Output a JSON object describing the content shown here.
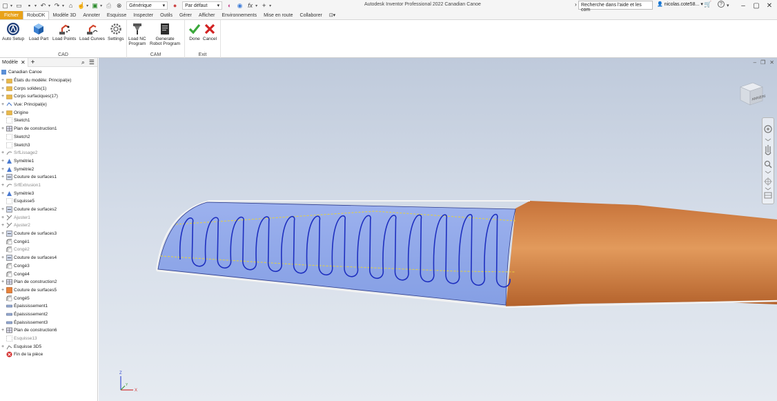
{
  "titlebar": {
    "app_title": "Autodesk Inventor Professional 2022   Canadian Canoe",
    "material": "Générique",
    "appearance": "Par défaut",
    "fx": "fx",
    "search_placeholder": "Recherche dans l'aide et les com",
    "user": "nicolas.cote58...",
    "help": "?"
  },
  "menu": {
    "tabs": [
      "Fichier",
      "RoboDK",
      "Modèle 3D",
      "Annoter",
      "Esquisse",
      "Inspecter",
      "Outils",
      "Gérer",
      "Afficher",
      "Environnements",
      "Mise en route",
      "Collaborer",
      "⊡▾"
    ],
    "active": "RoboDK"
  },
  "ribbon": {
    "groups": [
      {
        "label": "CAD",
        "buttons": [
          {
            "line1": "Auto Setup",
            "line2": ""
          },
          {
            "line1": "Load Part",
            "line2": ""
          },
          {
            "line1": "Load Points",
            "line2": ""
          },
          {
            "line1": "Load Curves",
            "line2": ""
          },
          {
            "line1": "Settings",
            "line2": ""
          }
        ]
      },
      {
        "label": "CAM",
        "buttons": [
          {
            "line1": "Load NC",
            "line2": "Program"
          },
          {
            "line1": "Generate",
            "line2": "Robot Program"
          }
        ]
      },
      {
        "label": "Exit",
        "buttons": [
          {
            "line1": "Done",
            "line2": ""
          },
          {
            "line1": "Cancel",
            "line2": ""
          }
        ]
      }
    ]
  },
  "browser": {
    "tab": "Modèle",
    "root": "Canadian Canoe",
    "nodes": [
      {
        "label": "États du modèle: Principal(e)",
        "icon": "folder",
        "exp": "+",
        "dim": false
      },
      {
        "label": "Corps solides(1)",
        "icon": "folder",
        "exp": "+",
        "dim": false
      },
      {
        "label": "Corps surfaciques(17)",
        "icon": "folder",
        "exp": "+",
        "dim": false
      },
      {
        "label": "Vue: Principal(e)",
        "icon": "view",
        "exp": "+",
        "dim": false
      },
      {
        "label": "Origine",
        "icon": "folder",
        "exp": "+",
        "dim": false
      },
      {
        "label": "Sketch1",
        "icon": "sketch",
        "exp": "",
        "dim": false
      },
      {
        "label": "Plan de construction1",
        "icon": "plane",
        "exp": "+",
        "dim": false
      },
      {
        "label": "Sketch2",
        "icon": "sketch",
        "exp": "",
        "dim": false
      },
      {
        "label": "Sketch3",
        "icon": "sketch",
        "exp": "",
        "dim": false
      },
      {
        "label": "SrfLissage2",
        "icon": "surface",
        "exp": "+",
        "dim": true
      },
      {
        "label": "Symétrie1",
        "icon": "mirror",
        "exp": "+",
        "dim": false
      },
      {
        "label": "Symétrie2",
        "icon": "mirror",
        "exp": "+",
        "dim": false
      },
      {
        "label": "Couture de surfaces1",
        "icon": "stitch",
        "exp": "+",
        "dim": false
      },
      {
        "label": "SrfExtrusion1",
        "icon": "surface",
        "exp": "+",
        "dim": true
      },
      {
        "label": "Symétrie3",
        "icon": "mirror",
        "exp": "+",
        "dim": false
      },
      {
        "label": "Esquisse5",
        "icon": "sketch",
        "exp": "",
        "dim": false
      },
      {
        "label": "Couture de surfaces2",
        "icon": "stitch",
        "exp": "+",
        "dim": false
      },
      {
        "label": "Ajuster1",
        "icon": "trim",
        "exp": "+",
        "dim": true
      },
      {
        "label": "Ajuster2",
        "icon": "trim",
        "exp": "+",
        "dim": true
      },
      {
        "label": "Couture de surfaces3",
        "icon": "stitch",
        "exp": "+",
        "dim": false
      },
      {
        "label": "Congé1",
        "icon": "fillet",
        "exp": "",
        "dim": false
      },
      {
        "label": "Congé2",
        "icon": "fillet",
        "exp": "",
        "dim": true
      },
      {
        "label": "Couture de surfaces4",
        "icon": "stitch",
        "exp": "+",
        "dim": false
      },
      {
        "label": "Congé3",
        "icon": "fillet",
        "exp": "",
        "dim": false
      },
      {
        "label": "Congé4",
        "icon": "fillet",
        "exp": "",
        "dim": false
      },
      {
        "label": "Plan de construction2",
        "icon": "plane",
        "exp": "+",
        "dim": false
      },
      {
        "label": "Couture de surfaces5",
        "icon": "stitch-orange",
        "exp": "+",
        "dim": false
      },
      {
        "label": "Congé5",
        "icon": "fillet",
        "exp": "",
        "dim": false
      },
      {
        "label": "Épaississement1",
        "icon": "thicken",
        "exp": "",
        "dim": false
      },
      {
        "label": "Épaississement2",
        "icon": "thicken",
        "exp": "",
        "dim": false
      },
      {
        "label": "Épaississement3",
        "icon": "thicken",
        "exp": "",
        "dim": false
      },
      {
        "label": "Plan de construction6",
        "icon": "plane",
        "exp": "+",
        "dim": false
      },
      {
        "label": "Esquisse13",
        "icon": "sketch",
        "exp": "",
        "dim": true
      },
      {
        "label": "Esquisse 3D5",
        "icon": "sketch3d",
        "exp": "+",
        "dim": false
      },
      {
        "label": "Fin de la pièce",
        "icon": "end",
        "exp": "",
        "dim": false
      }
    ]
  },
  "viewport": {
    "viewcube_label": "ARRIÈRE",
    "triad": {
      "x": "X",
      "y": "Y",
      "z": "Z"
    }
  },
  "colors": {
    "file_tab": "#e8a21a",
    "hull_orange": "#d98a4a",
    "patch_blue": "#8ea6e8",
    "toolpath": "#1e2fbf",
    "guide_yellow": "#e8d23a"
  }
}
